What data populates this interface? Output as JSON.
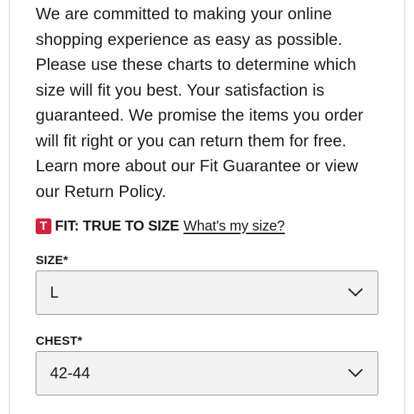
{
  "intro": {
    "text": "We are committed to making your online shopping experience as easy as possible. Please use these charts to determine which size will fit you best. Your satisfaction is guaranteed. We promise the items you order will fit right or you can return them for free. Learn more about our Fit Guarantee or view our Return Policy."
  },
  "fit": {
    "badge": "T",
    "label": "FIT: TRUE TO SIZE",
    "link": "What's my size?",
    "badge_color": "#d4213d"
  },
  "size_field": {
    "label": "SIZE*",
    "value": "L",
    "icon": "chevron-down-icon"
  },
  "chest_field": {
    "label": "CHEST*",
    "value": "42-44",
    "icon": "chevron-down-icon"
  }
}
